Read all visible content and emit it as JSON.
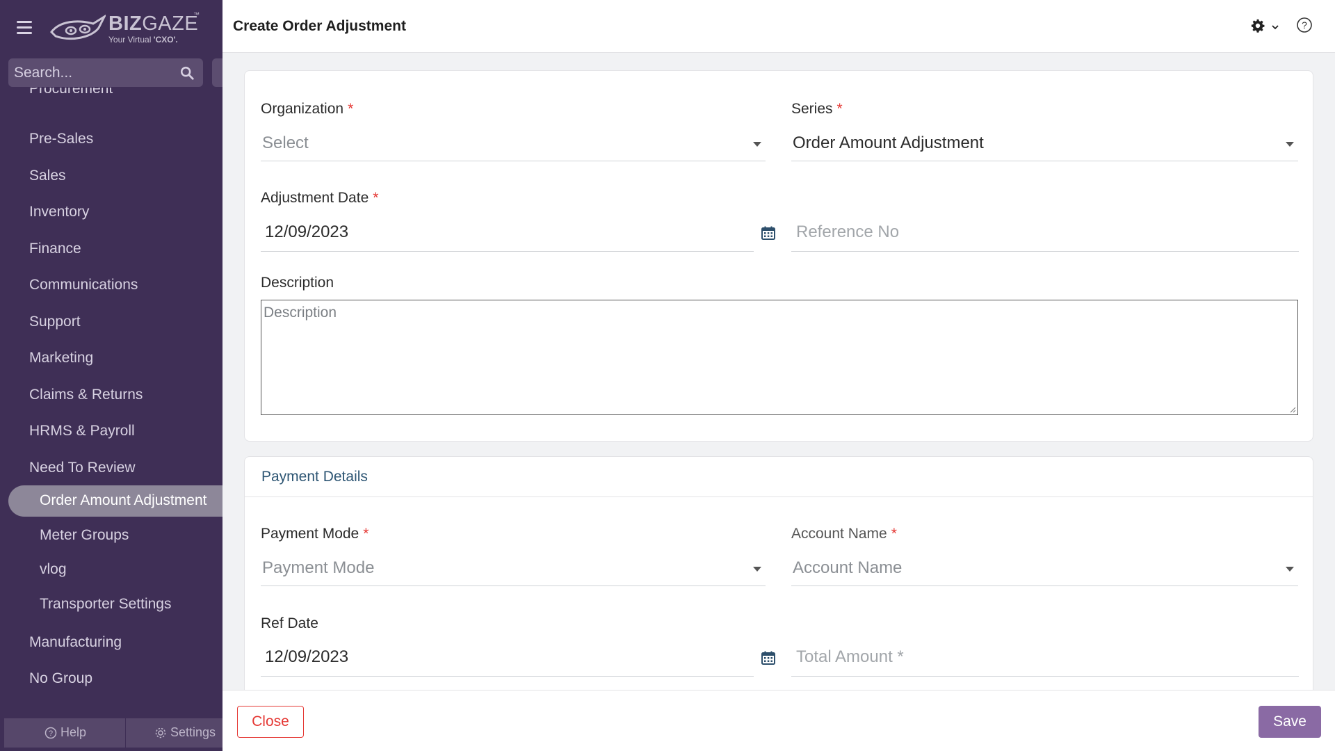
{
  "app": {
    "logo_word_bold": "BIZ",
    "logo_word_light": "GAZE",
    "logo_tm": "™",
    "logo_tag_prefix": "Your Virtual ",
    "logo_tag_strong": "'CXO'."
  },
  "sidebar": {
    "search_placeholder": "Search...",
    "items": [
      {
        "label": "Procurement"
      },
      {
        "label": "Pre-Sales"
      },
      {
        "label": "Sales"
      },
      {
        "label": "Inventory"
      },
      {
        "label": "Finance"
      },
      {
        "label": "Communications"
      },
      {
        "label": "Support"
      },
      {
        "label": "Marketing"
      },
      {
        "label": "Claims & Returns"
      },
      {
        "label": "HRMS & Payroll"
      },
      {
        "label": "Need To Review"
      }
    ],
    "sub_items": [
      {
        "label": "Order Amount Adjustment",
        "active": true
      },
      {
        "label": "Meter Groups"
      },
      {
        "label": "vlog"
      },
      {
        "label": "Transporter Settings"
      }
    ],
    "items_after": [
      {
        "label": "Manufacturing"
      },
      {
        "label": "No Group"
      }
    ],
    "footer": {
      "help": "Help",
      "settings": "Settings"
    }
  },
  "header": {
    "title": "Create Order Adjustment"
  },
  "form": {
    "organization": {
      "label": "Organization",
      "placeholder": "Select"
    },
    "series": {
      "label": "Series",
      "value": "Order Amount Adjustment"
    },
    "adjustment_date": {
      "label": "Adjustment Date",
      "value": "12/09/2023"
    },
    "reference_no": {
      "placeholder": "Reference No"
    },
    "description": {
      "label": "Description",
      "placeholder": "Description"
    },
    "required_mark": "*"
  },
  "payment": {
    "section_title": "Payment Details",
    "payment_mode": {
      "label": "Payment Mode",
      "placeholder": "Payment Mode"
    },
    "account_name": {
      "label": "Account Name",
      "placeholder": "Account Name"
    },
    "ref_date": {
      "label": "Ref Date",
      "value": "12/09/2023"
    },
    "total_amount": {
      "placeholder": "Total Amount *"
    }
  },
  "footer": {
    "close_label": "Close",
    "save_label": "Save"
  },
  "colors": {
    "sidebar_bg": "#3f2f56",
    "accent": "#8a6aa4",
    "danger": "#e53935",
    "section_title": "#2d5573"
  }
}
